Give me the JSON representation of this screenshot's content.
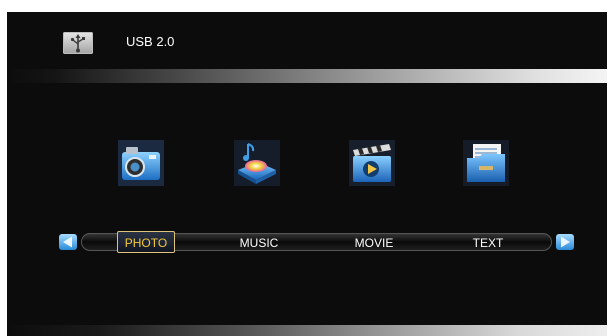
{
  "header": {
    "title": "USB 2.0",
    "icon": "usb-icon"
  },
  "menu": {
    "selected_index": 0,
    "items": [
      {
        "label": "PHOTO",
        "icon": "photo-camera-icon"
      },
      {
        "label": "MUSIC",
        "icon": "music-disc-icon"
      },
      {
        "label": "MOVIE",
        "icon": "movie-clapper-icon"
      },
      {
        "label": "TEXT",
        "icon": "text-folder-icon"
      }
    ]
  },
  "navigation": {
    "left_arrow_icon": "arrow-left-icon",
    "right_arrow_icon": "arrow-right-icon"
  },
  "colors": {
    "screen_background": "#0c0c0c",
    "selected_text": "#f3c83a",
    "menu_text": "#ffffff",
    "arrow_blue": "#3aa6e8"
  }
}
